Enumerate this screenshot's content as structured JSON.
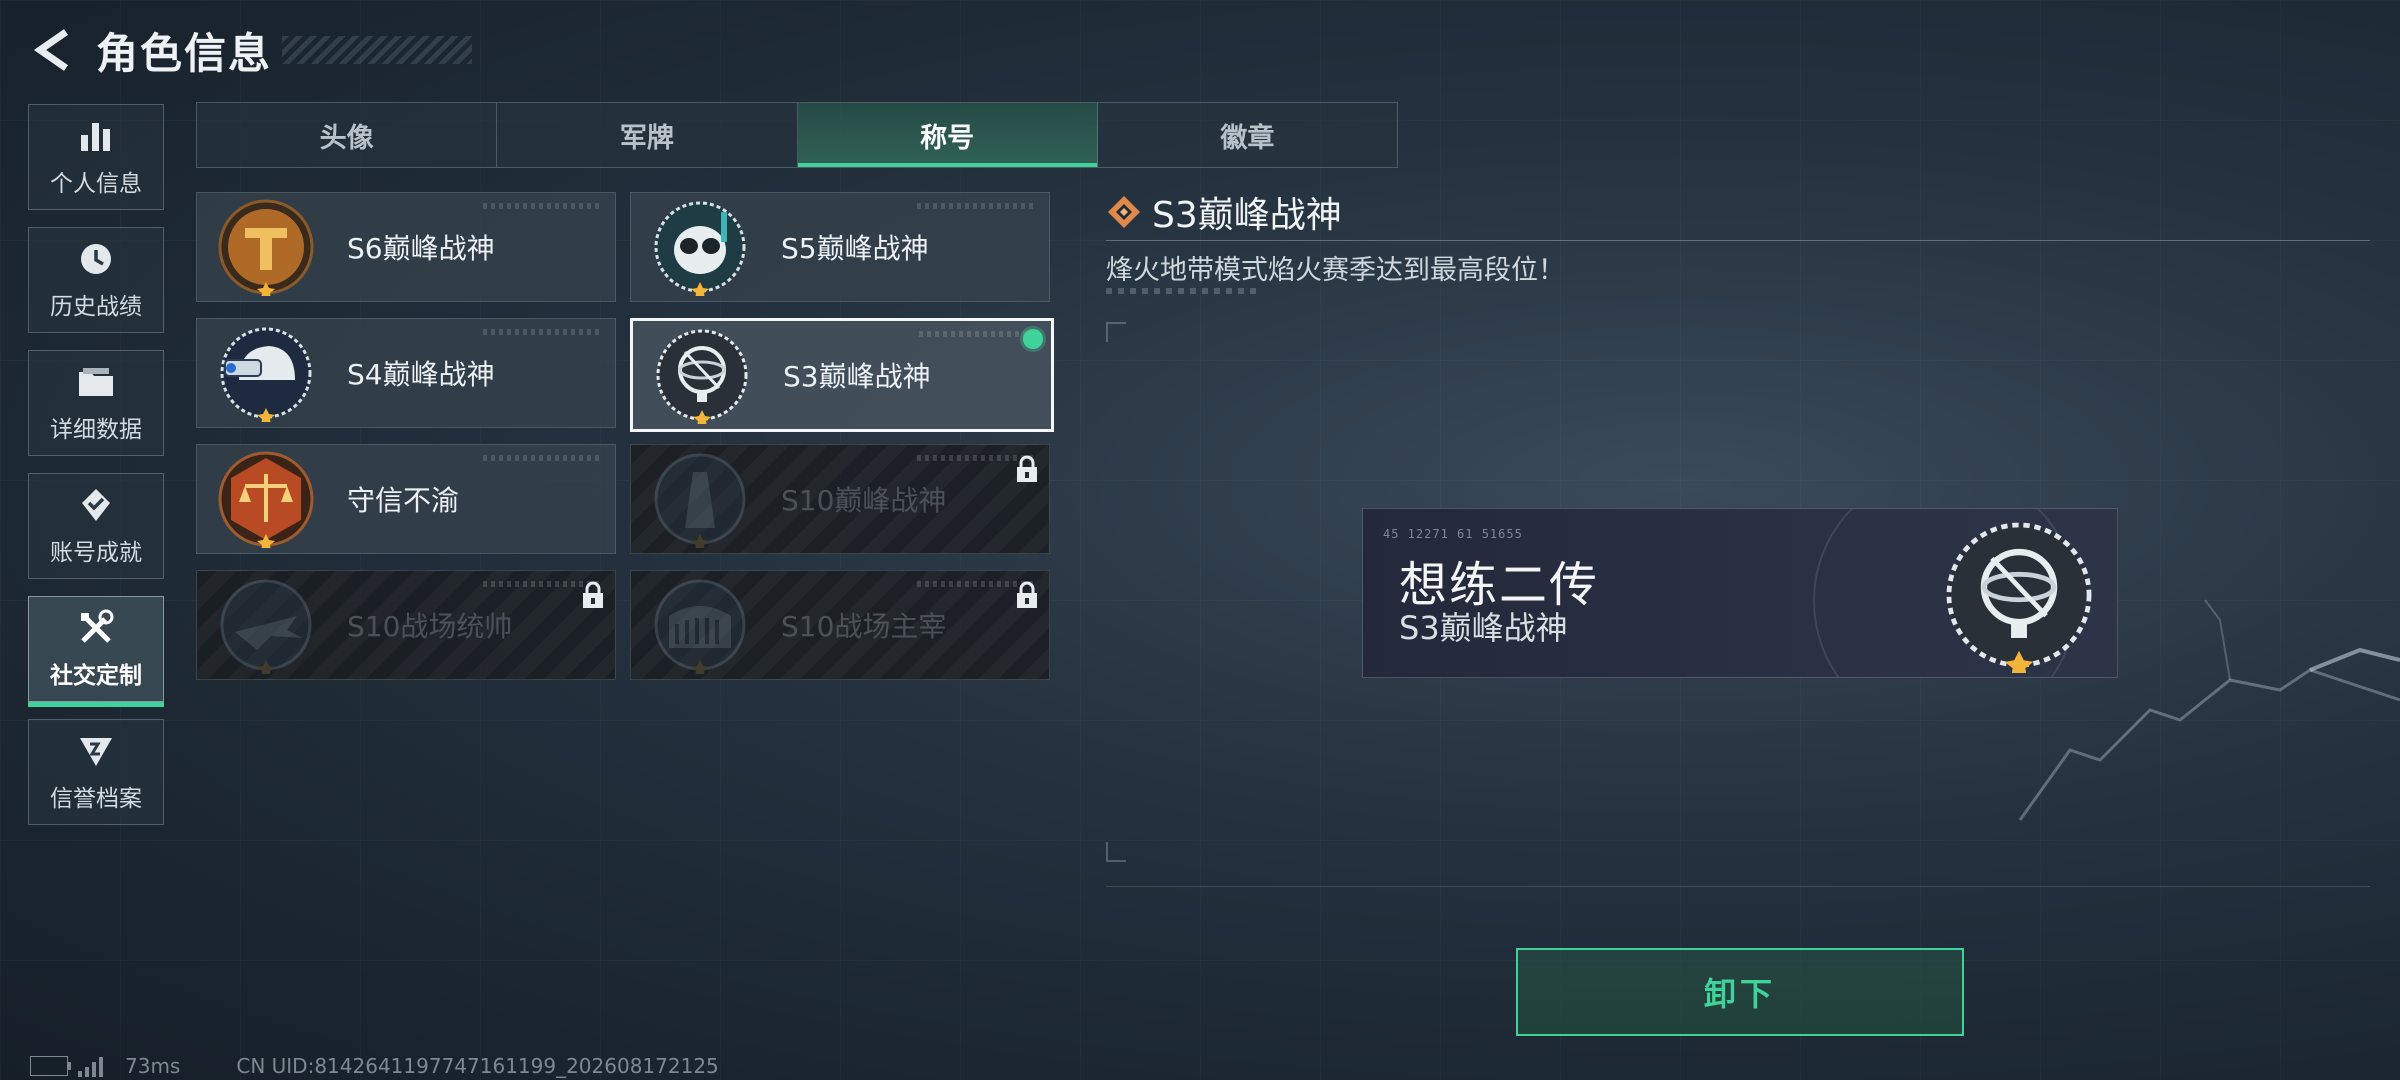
{
  "header": {
    "title": "角色信息"
  },
  "sidebar": {
    "items": [
      {
        "label": "个人信息",
        "icon": "bar-chart-icon",
        "active": false
      },
      {
        "label": "历史战绩",
        "icon": "clock-icon",
        "active": false
      },
      {
        "label": "详细数据",
        "icon": "folder-icon",
        "active": false
      },
      {
        "label": "账号成就",
        "icon": "achievement-icon",
        "active": false
      },
      {
        "label": "社交定制",
        "icon": "tools-icon",
        "active": true
      },
      {
        "label": "信誉档案",
        "icon": "reputation-icon",
        "active": false
      }
    ]
  },
  "tabs": [
    {
      "label": "头像",
      "active": false
    },
    {
      "label": "军牌",
      "active": false
    },
    {
      "label": "称号",
      "active": true
    },
    {
      "label": "徽章",
      "active": false
    }
  ],
  "titles": [
    {
      "label": "S6巅峰战神",
      "locked": false,
      "selected": false,
      "equipped": false,
      "emblem": "gold-t-emblem-icon"
    },
    {
      "label": "S5巅峰战神",
      "locked": false,
      "selected": false,
      "equipped": false,
      "emblem": "diver-skull-emblem-icon"
    },
    {
      "label": "S4巅峰战神",
      "locked": false,
      "selected": false,
      "equipped": false,
      "emblem": "night-vision-helmet-emblem-icon"
    },
    {
      "label": "S3巅峰战神",
      "locked": false,
      "selected": true,
      "equipped": true,
      "emblem": "armillary-sphere-emblem-icon"
    },
    {
      "label": "守信不渝",
      "locked": false,
      "selected": false,
      "equipped": false,
      "emblem": "scales-emblem-icon"
    },
    {
      "label": "S10巅峰战神",
      "locked": true,
      "selected": false,
      "equipped": false,
      "emblem": "tower-emblem-icon"
    },
    {
      "label": "S10战场统帅",
      "locked": true,
      "selected": false,
      "equipped": false,
      "emblem": "aircraft-emblem-icon"
    },
    {
      "label": "S10战场主宰",
      "locked": true,
      "selected": false,
      "equipped": false,
      "emblem": "colosseum-emblem-icon"
    }
  ],
  "detail": {
    "title": "S3巅峰战神",
    "description": "烽火地带模式焰火赛季达到最高段位！",
    "preview": {
      "player_name": "想练二传",
      "title": "S3巅峰战神",
      "tag": "45 12271  61 51655"
    },
    "unequip_label": "卸下"
  },
  "status": {
    "ping": "73ms",
    "uid": "CN UID:8142641197747161199_202608172125"
  },
  "colors": {
    "accent": "#3fd29a",
    "background": "#1f2a35",
    "card": "#37444e",
    "locked_text": "#4a5258",
    "diamond": "#e0894a"
  }
}
